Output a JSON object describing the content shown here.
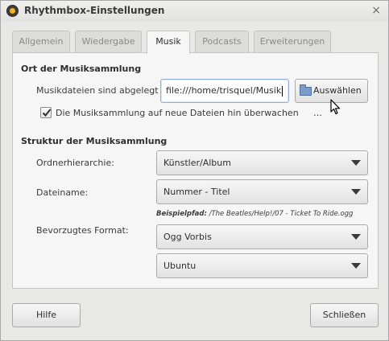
{
  "window": {
    "title": "Rhythmbox-Einstellungen",
    "close_glyph": "×"
  },
  "tabs": [
    {
      "label": "Allgemein",
      "active": false
    },
    {
      "label": "Wiedergabe",
      "active": false
    },
    {
      "label": "Musik",
      "active": true
    },
    {
      "label": "Podcasts",
      "active": false
    },
    {
      "label": "Erweiterungen",
      "active": false
    }
  ],
  "location": {
    "heading": "Ort der Musiksammlung",
    "path_label": "Musikdateien sind abgelegt in:",
    "path_value": "file:///home/trisquel/Musik",
    "choose_button": "Auswählen …",
    "watch_checkbox_label": "Die Musiksammlung auf neue Dateien hin überwachen",
    "watch_checked": true
  },
  "structure": {
    "heading": "Struktur der Musiksammlung",
    "folder_label": "Ordnerhierarchie:",
    "folder_value": "Künstler/Album",
    "filename_label": "Dateiname:",
    "filename_value": "Nummer - Titel",
    "example_prefix": "Beispielpfad:",
    "example_path": "/The Beatles/Help!/07 - Ticket To Ride.ogg",
    "format_label": "Bevorzugtes Format:",
    "format_value": "Ogg Vorbis",
    "preset_value": "Ubuntu"
  },
  "footer": {
    "help_button": "Hilfe",
    "close_button": "Schließen"
  },
  "icons": {
    "app": "rhythmbox-icon",
    "folder": "folder-icon",
    "check": "checkmark-icon",
    "dropdown": "chevron-down-icon",
    "pointer": "mouse-pointer-icon"
  }
}
